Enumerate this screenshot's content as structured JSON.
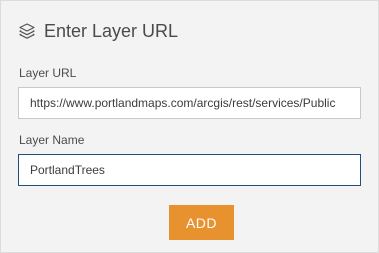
{
  "header": {
    "icon": "layers-icon",
    "title": "Enter Layer URL"
  },
  "form": {
    "url_label": "Layer URL",
    "url_value": "https://www.portlandmaps.com/arcgis/rest/services/Public",
    "name_label": "Layer Name",
    "name_value": "PortlandTrees"
  },
  "actions": {
    "add_label": "ADD",
    "add_color": "#e8922f"
  }
}
